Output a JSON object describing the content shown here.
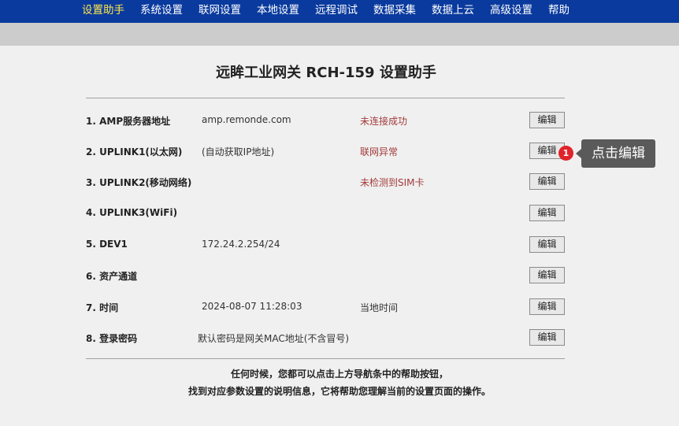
{
  "nav": {
    "items": [
      {
        "label": "设置助手"
      },
      {
        "label": "系统设置"
      },
      {
        "label": "联网设置"
      },
      {
        "label": "本地设置"
      },
      {
        "label": "远程调试"
      },
      {
        "label": "数据采集"
      },
      {
        "label": "数据上云"
      },
      {
        "label": "高级设置"
      },
      {
        "label": "帮助"
      }
    ],
    "active_color": "#ffe84a",
    "bar_color": "#0a3a9e"
  },
  "page": {
    "title": "远眸工业网关 RCH-159  设置助手"
  },
  "rows": [
    {
      "name": "1. AMP服务器地址",
      "value": "amp.remonde.com",
      "status": "未连接成功",
      "edit": "编辑"
    },
    {
      "name": "2. UPLINK1(以太网)",
      "value": "(自动获取IP地址)",
      "status": "联网异常",
      "edit": "编辑"
    },
    {
      "name": "3. UPLINK2(移动网络)",
      "value": "",
      "status": "未检测到SIM卡",
      "edit": "编辑"
    },
    {
      "name": "4. UPLINK3(WiFi)",
      "value": "",
      "status": "",
      "edit": "编辑"
    },
    {
      "name": "5. DEV1",
      "value": "172.24.2.254/24",
      "status": "",
      "edit": "编辑"
    },
    {
      "name": "6. 资产通道",
      "value": "",
      "status": "",
      "edit": "编辑"
    },
    {
      "name": "7. 时间",
      "value": "2024-08-07 11:28:03",
      "status": "当地时间",
      "edit": "编辑"
    },
    {
      "name": "8. 登录密码",
      "value": "默认密码是网关MAC地址(不含冒号)",
      "status": "",
      "edit": "编辑"
    }
  ],
  "status_color": "#a33a3a",
  "footer": {
    "line1": "任何时候，您都可以点击上方导航条中的帮助按钮，",
    "line2": "找到对应参数设置的说明信息，它将帮助您理解当前的设置页面的操作。"
  },
  "annotation": {
    "badge": "1",
    "tooltip": "点击编辑"
  }
}
